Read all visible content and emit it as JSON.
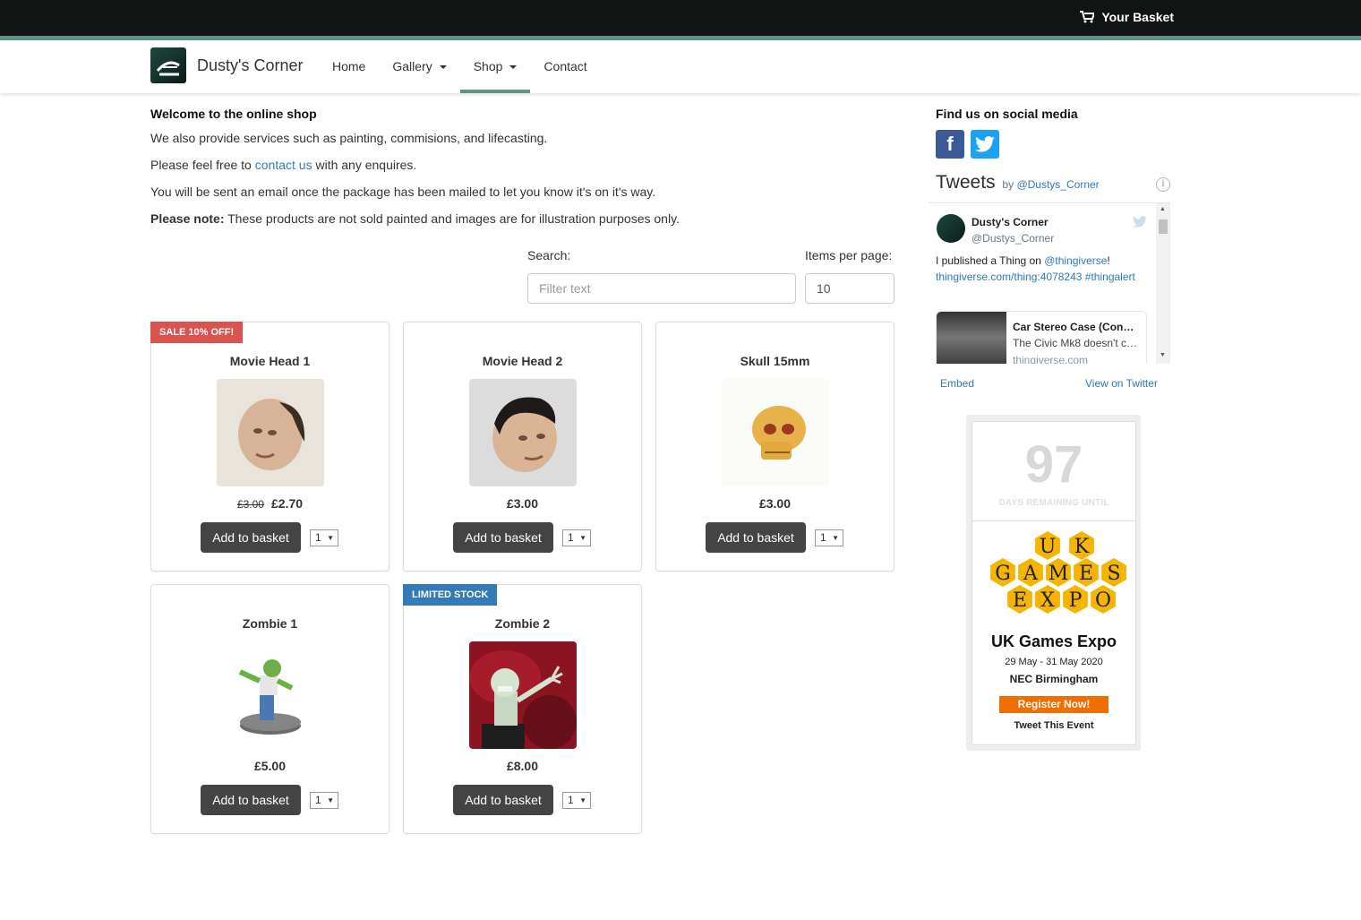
{
  "header": {
    "basket_label": "Your Basket",
    "brand": "Dusty's Corner"
  },
  "nav": {
    "items": [
      {
        "label": "Home",
        "dropdown": false,
        "active": false
      },
      {
        "label": "Gallery",
        "dropdown": true,
        "active": false
      },
      {
        "label": "Shop",
        "dropdown": true,
        "active": true
      },
      {
        "label": "Contact",
        "dropdown": false,
        "active": false
      }
    ]
  },
  "intro": {
    "heading": "Welcome to the online shop",
    "line1": "We also provide services such as painting, commisions, and lifecasting.",
    "line2_pre": "Please feel free to ",
    "line2_link": "contact us",
    "line2_post": " with any enquires.",
    "line3": "You will be sent an email once the package has been mailed to let you know it's on it's way.",
    "note_label": "Please note:",
    "note_text": " These products are not sold painted and images are for illustration purposes only."
  },
  "search": {
    "label": "Search:",
    "placeholder": "Filter text",
    "per_page_label": "Items per page:",
    "per_page_value": "10"
  },
  "products": [
    {
      "name": "Movie Head 1",
      "badge": "SALE 10% OFF!",
      "old_price": "£3.00",
      "price": "£2.70",
      "button": "Add to basket",
      "qty": "1"
    },
    {
      "name": "Movie Head 2",
      "badge": "",
      "old_price": "",
      "price": "£3.00",
      "button": "Add to basket",
      "qty": "1"
    },
    {
      "name": "Skull 15mm",
      "badge": "",
      "old_price": "",
      "price": "£3.00",
      "button": "Add to basket",
      "qty": "1"
    },
    {
      "name": "Zombie 1",
      "badge": "",
      "old_price": "",
      "price": "£5.00",
      "button": "Add to basket",
      "qty": "1"
    },
    {
      "name": "Zombie 2",
      "badge": "LIMITED STOCK",
      "old_price": "",
      "price": "£8.00",
      "button": "Add to basket",
      "qty": "1"
    }
  ],
  "sidebar": {
    "social_title": "Find us on social media",
    "social_icons": [
      "facebook-icon",
      "twitter-icon"
    ],
    "tweets": {
      "title": "Tweets",
      "by": "by",
      "handle_link": "@Dustys_Corner",
      "author_name": "Dusty's Corner",
      "author_handle": "@Dustys_Corner",
      "text_pre": "I published a Thing on ",
      "text_mention": "@thingiverse",
      "text_mid": "!",
      "text_link": "thingiverse.com/thing:4078243",
      "text_tag": "#thingalert",
      "card_title": "Car Stereo Case (Con…",
      "card_desc": "The Civic Mk8 doesn't c…",
      "card_url": "thingiverse.com",
      "embed": "Embed",
      "view": "View on Twitter"
    },
    "event": {
      "days": "97",
      "days_label": "DAYS REMAINING UNTIL",
      "logo_letters": [
        "U",
        "K",
        "G",
        "A",
        "M",
        "E",
        "S",
        "E",
        "X",
        "P",
        "O"
      ],
      "name": "UK Games Expo",
      "dates": "29 May - 31 May 2020",
      "venue": "NEC Birmingham",
      "register": "Register Now!",
      "tweet": "Tweet This Event"
    }
  },
  "colors": {
    "topbar": "#121414",
    "accent": "#5e9487",
    "sale_badge": "#d9534f",
    "stock_badge": "#337ab7",
    "button": "#444444",
    "register": "#f06d00",
    "hex_gold": "#f4b400"
  }
}
